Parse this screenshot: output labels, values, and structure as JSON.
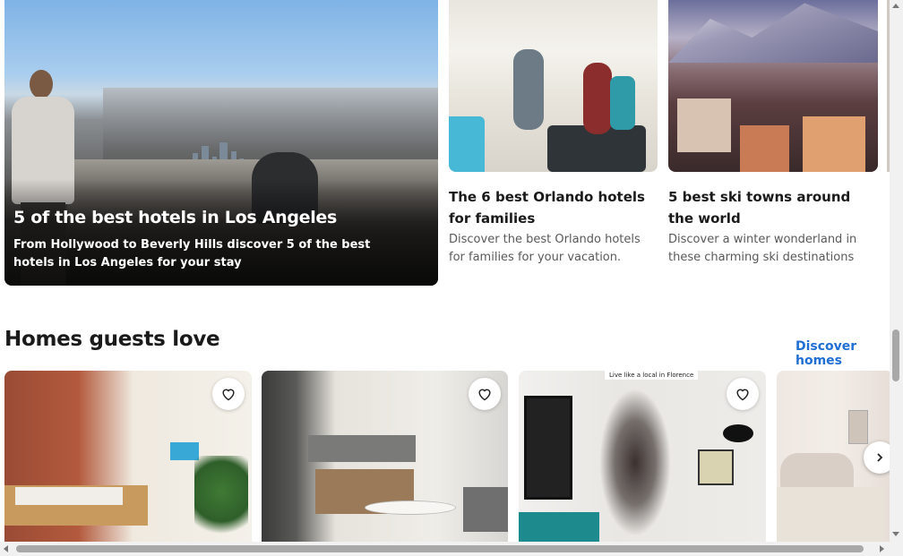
{
  "featured": {
    "title": "5 of the best hotels in Los Angeles",
    "description": "From Hollywood to Beverly Hills discover 5 of the best hotels in Los Angeles for your stay"
  },
  "articles": [
    {
      "title": "The 6 best Orlando hotels for families",
      "description": "Discover the best Orlando hotels for families for your vacation."
    },
    {
      "title": "5 best ski towns around the world",
      "description": "Discover a winter wonderland in these charming ski destinations"
    }
  ],
  "homes_section": {
    "title": "Homes guests love",
    "link_label": "Discover homes",
    "cards": [
      {
        "image": "brick-wall-loft-bedroom"
      },
      {
        "image": "modern-kitchen-dining"
      },
      {
        "image": "spiral-staircase-living",
        "overlay_text": "Live like a local in Florence"
      },
      {
        "image": "bedroom-tufted-headboard"
      }
    ]
  },
  "icons": {
    "favorite": "heart-outline-icon",
    "next": "chevron-right-icon"
  },
  "colors": {
    "link": "#1f6ed4",
    "text": "#1a1a1a",
    "muted": "#595959"
  }
}
